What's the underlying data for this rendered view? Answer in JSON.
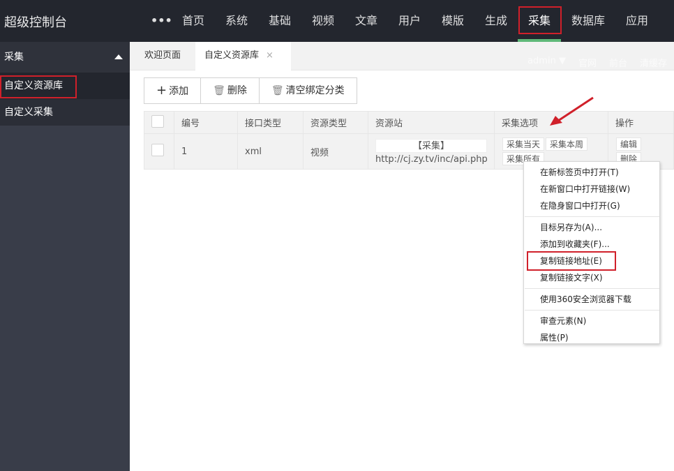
{
  "app": {
    "title": "超级控制台"
  },
  "nav": {
    "more": "•••",
    "items": [
      "首页",
      "系统",
      "基础",
      "视频",
      "文章",
      "用户",
      "模版",
      "生成",
      "采集",
      "数据库",
      "应用"
    ],
    "active": "采集"
  },
  "header_right": {
    "user": "admin ▼",
    "links": [
      "官网",
      "前台",
      "清缓存"
    ]
  },
  "sidebar": {
    "section": "采集",
    "items": [
      "自定义资源库",
      "自定义采集"
    ],
    "selected": "自定义资源库"
  },
  "tabs": [
    {
      "label": "欢迎页面"
    },
    {
      "label": "自定义资源库",
      "close": "×"
    }
  ],
  "toolbar": {
    "add": "添加",
    "delete": "删除",
    "clear": "清空绑定分类"
  },
  "table": {
    "headers": [
      "编号",
      "接口类型",
      "资源类型",
      "资源站",
      "采集选项",
      "操作"
    ],
    "rows": [
      {
        "id": "1",
        "api_type": "xml",
        "res_type": "视频",
        "site_btn": "【采集】",
        "site_url": "http://cj.zy.tv/inc/api.php",
        "options": [
          "采集当天",
          "采集本周",
          "采集所有"
        ],
        "actions": [
          "编辑",
          "删除"
        ]
      }
    ]
  },
  "context_menu": {
    "groups": [
      [
        "在新标签页中打开(T)",
        "在新窗口中打开链接(W)",
        "在隐身窗口中打开(G)"
      ],
      [
        "目标另存为(A)...",
        "添加到收藏夹(F)...",
        "复制链接地址(E)",
        "复制链接文字(X)"
      ],
      [
        "使用360安全浏览器下载"
      ],
      [
        "审查元素(N)",
        "属性(P)"
      ]
    ],
    "highlighted": "复制链接地址(E)"
  },
  "colors": {
    "topbar": "#23262e",
    "sidebar": "#393d49",
    "accent": "#5fb878",
    "highlight": "#d0202a"
  }
}
